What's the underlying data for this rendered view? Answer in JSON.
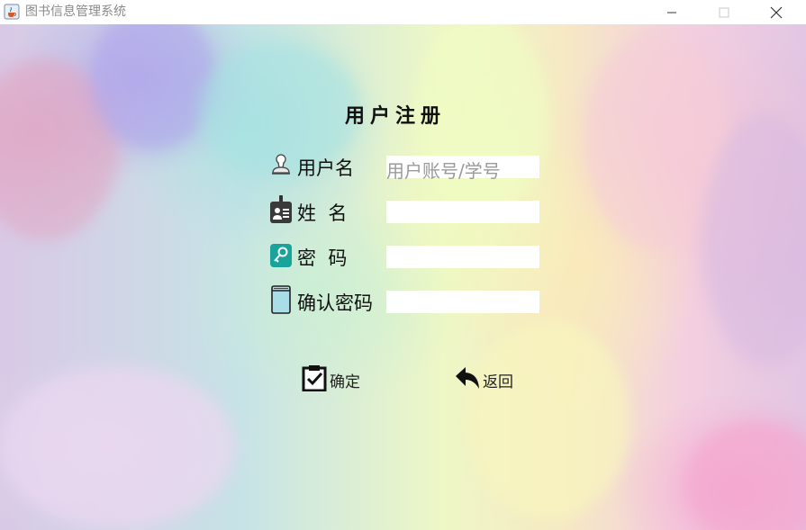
{
  "window": {
    "title": "图书信息管理系统",
    "icon": "java-coffee-icon"
  },
  "form": {
    "title": "用户注册",
    "fields": [
      {
        "label": "用户名",
        "icon": "user-stamp-icon",
        "value": "",
        "placeholder": "用户账号/学号"
      },
      {
        "label": "姓  名",
        "icon": "id-badge-icon",
        "value": "",
        "placeholder": ""
      },
      {
        "label": "密  码",
        "icon": "key-icon",
        "value": "",
        "placeholder": ""
      },
      {
        "label": "确认密码",
        "icon": "notebook-icon",
        "value": "",
        "placeholder": ""
      }
    ]
  },
  "buttons": {
    "confirm": {
      "label": "确定",
      "icon": "clipboard-check-icon"
    },
    "back": {
      "label": "返回",
      "icon": "reply-arrow-icon"
    }
  },
  "colors": {
    "key_icon": "#1aa39a",
    "notebook_icon": "#a9dde8"
  }
}
